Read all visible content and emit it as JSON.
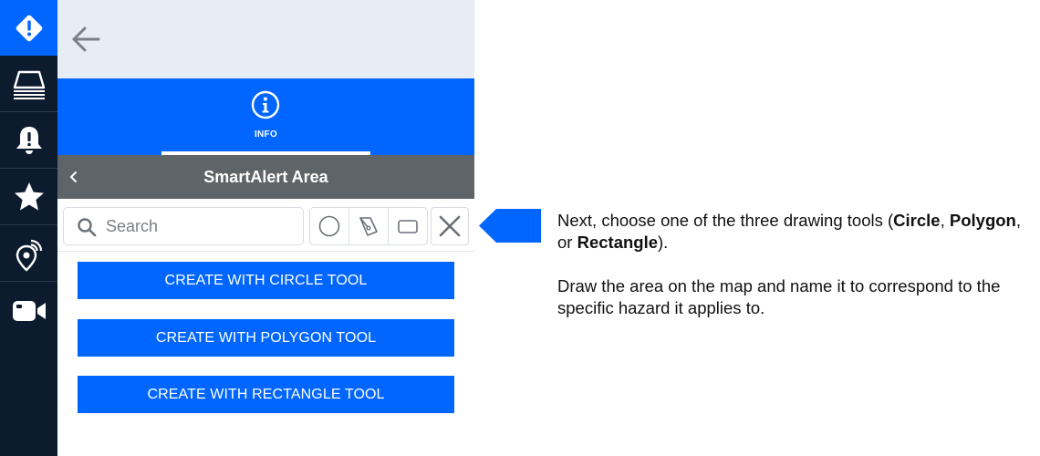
{
  "rail": {
    "items": [
      {
        "icon": "alert-diamond-icon",
        "active": true
      },
      {
        "icon": "layers-icon"
      },
      {
        "icon": "bell-alert-icon"
      },
      {
        "icon": "star-icon"
      },
      {
        "icon": "location-broadcast-icon"
      },
      {
        "icon": "video-camera-icon"
      }
    ]
  },
  "panel": {
    "tab": {
      "label": "INFO",
      "icon": "info-circle-icon"
    },
    "header": {
      "title": "SmartAlert Area"
    },
    "search": {
      "placeholder": "Search",
      "value": ""
    },
    "tools": [
      {
        "name": "circle-tool",
        "icon": "circle-outline-icon"
      },
      {
        "name": "polygon-tool",
        "icon": "polygon-pen-icon"
      },
      {
        "name": "rectangle-tool",
        "icon": "rectangle-outline-icon"
      },
      {
        "name": "close",
        "icon": "close-x-icon"
      }
    ],
    "buttons": {
      "circle": "CREATE WITH CIRCLE TOOL",
      "polygon": "CREATE WITH POLYGON TOOL",
      "rectangle": "CREATE WITH RECTANGLE TOOL"
    }
  },
  "callout": {
    "p1_part1": "Next, choose one of the three drawing tools (",
    "p1_circle": "Circle",
    "p1_sep1": ", ",
    "p1_polygon": "Polygon",
    "p1_sep2": ", or ",
    "p1_rectangle": "Rectangle",
    "p1_end": ").",
    "p2": "Draw the area on the map and name it to correspond to the specific hazard it applies to."
  },
  "colors": {
    "accent": "#0066ff",
    "rail": "#0d1b2e",
    "header": "#5f6468",
    "topbar": "#e7edf5"
  }
}
